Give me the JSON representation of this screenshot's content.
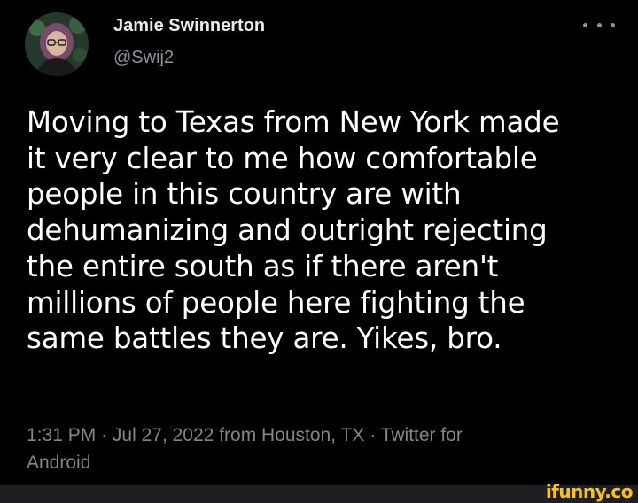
{
  "author": {
    "display_name": "Jamie Swinnerton",
    "handle": "@Swij2"
  },
  "tweet": {
    "lines": [
      "Moving to Texas from New York made",
      "it very clear to me how comfortable",
      "people in this country are with",
      "dehumanizing and outright rejecting",
      "the entire south as if there aren't",
      "millions of people here fighting the",
      "same battles they are. Yikes, bro."
    ],
    "time": "1:31 PM",
    "date": "Jul 27, 2022",
    "location": "from Houston, TX",
    "source_line1": "Twitter for",
    "source_line2": "Android",
    "separator": "·"
  },
  "watermark": {
    "text": "ifunny.co"
  },
  "icons": {
    "more": "more-horizontal-icon",
    "avatar": "avatar"
  },
  "colors": {
    "background": "#000000",
    "primary_text": "#ffffff",
    "secondary_text": "#80868b",
    "watermark": "#ffc400",
    "footer_bar": "#1e1f22"
  }
}
